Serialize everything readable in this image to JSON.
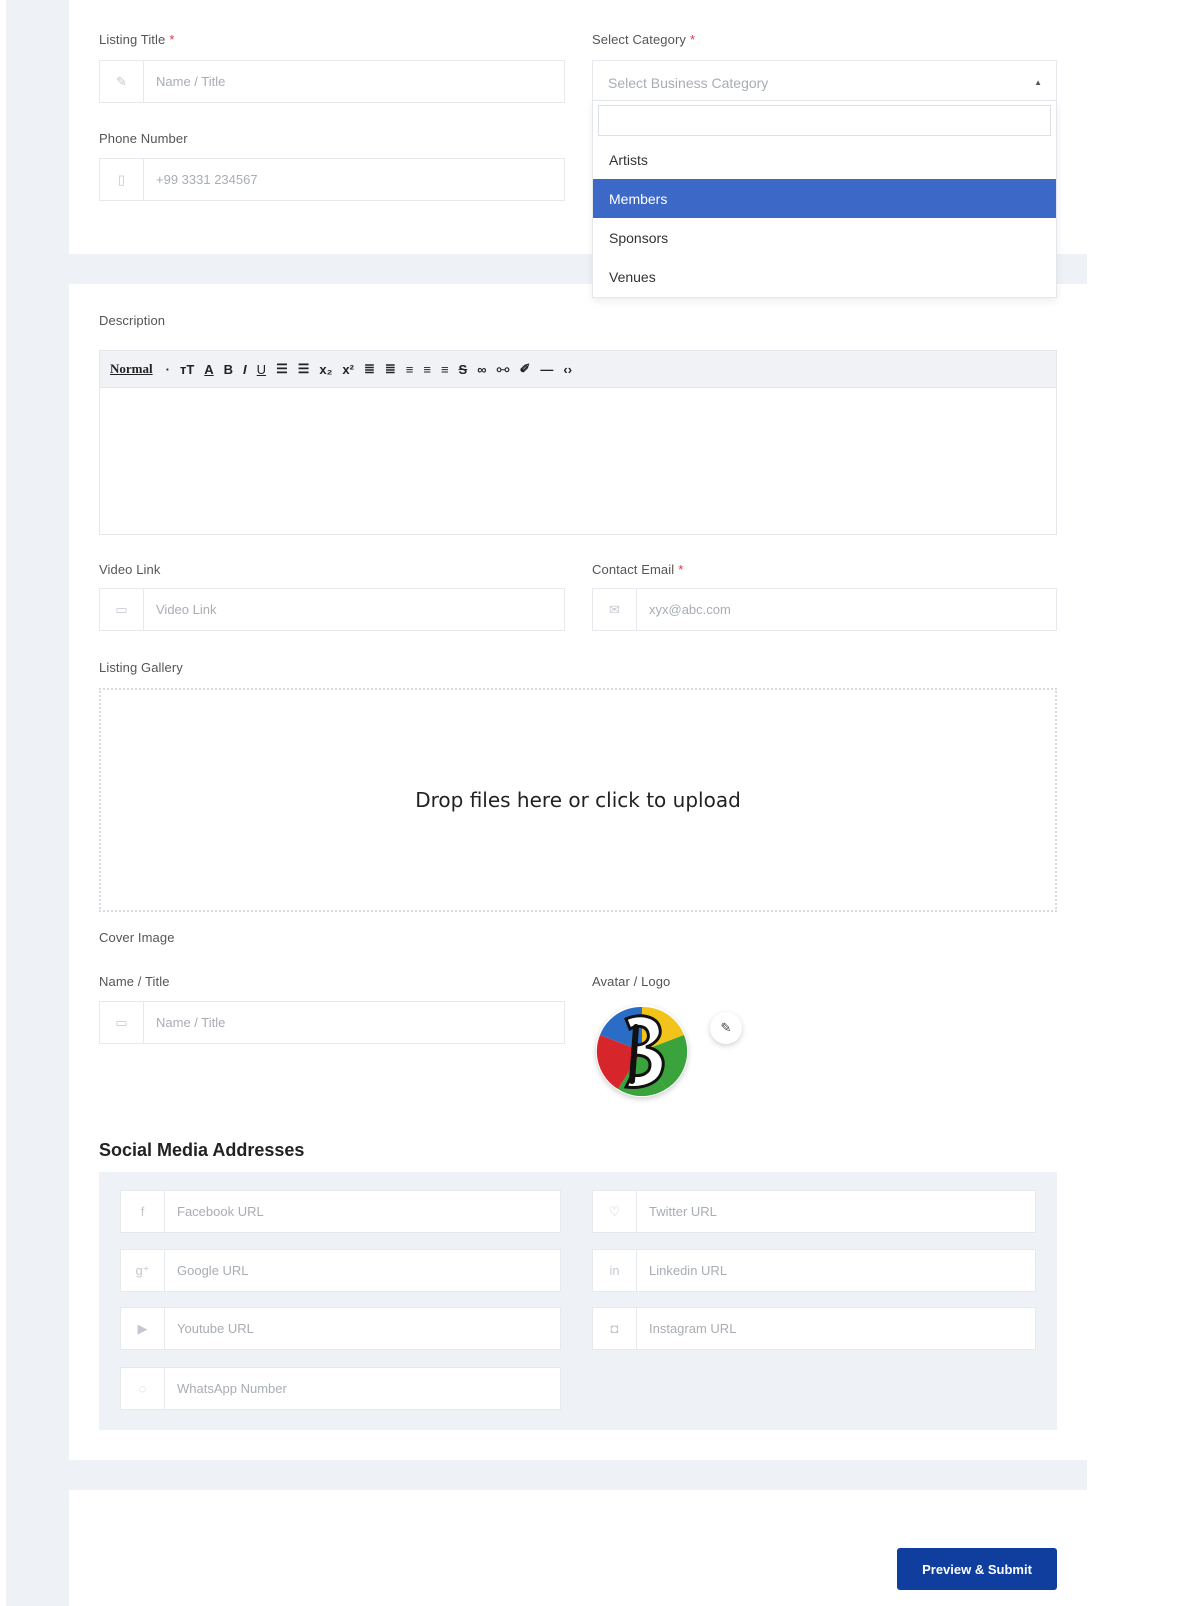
{
  "listing": {
    "title_label": "Listing Title",
    "required_mark": "*",
    "title_placeholder": "Name / Title",
    "phone_label": "Phone Number",
    "phone_placeholder": "+99 3331 234567"
  },
  "category": {
    "label": "Select Category",
    "placeholder": "Select Business Category",
    "options": [
      "Artists",
      "Members",
      "Sponsors",
      "Venues"
    ],
    "highlighted": "Members"
  },
  "description": {
    "label": "Description",
    "toolbar_format": "Normal"
  },
  "video": {
    "label": "Video Link",
    "placeholder": "Video Link"
  },
  "email": {
    "label": "Contact Email",
    "placeholder": "xyx@abc.com"
  },
  "gallery": {
    "label": "Listing Gallery",
    "dropzone_text": "Drop files here or click to upload"
  },
  "cover": {
    "label": "Cover Image",
    "name_label": "Name / Title",
    "name_placeholder": "Name / Title",
    "avatar_label": "Avatar / Logo"
  },
  "social": {
    "title": "Social Media Addresses",
    "facebook": "Facebook URL",
    "twitter": "Twitter URL",
    "google": "Google URL",
    "linkedin": "Linkedin URL",
    "youtube": "Youtube URL",
    "instagram": "Instagram URL",
    "whatsapp": "WhatsApp Number"
  },
  "submit_label": "Preview & Submit",
  "colors": {
    "accent": "#3c68c7",
    "submit": "#0f3e9e",
    "required": "#e0314b"
  }
}
